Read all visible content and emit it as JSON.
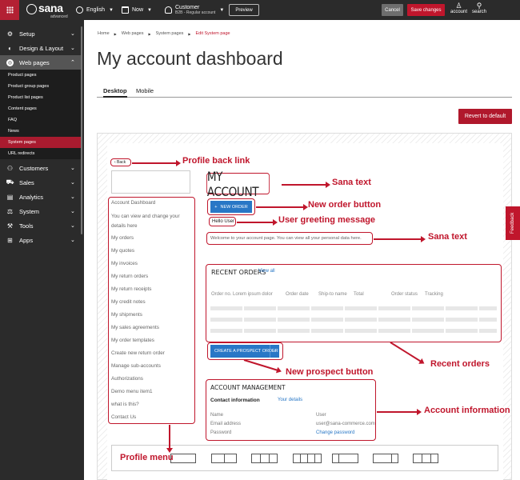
{
  "topbar": {
    "brand": "sana",
    "brand_sub": "advanced",
    "language": "English",
    "date": "Now",
    "customer_name": "Customer",
    "customer_type": "B2B - Regular account",
    "preview": "Preview",
    "cancel": "Cancel",
    "save": "Save changes",
    "account": "account",
    "search": "search"
  },
  "sidebar": {
    "items": [
      {
        "label": "Setup",
        "icon": "gear-icon"
      },
      {
        "label": "Design & Layout",
        "icon": "palette-icon"
      },
      {
        "label": "Web pages",
        "icon": "globe-icon"
      },
      {
        "label": "Customers",
        "icon": "people-icon"
      },
      {
        "label": "Sales",
        "icon": "cart-icon"
      },
      {
        "label": "Analytics",
        "icon": "chart-icon"
      },
      {
        "label": "System",
        "icon": "system-icon"
      },
      {
        "label": "Tools",
        "icon": "wrench-icon"
      },
      {
        "label": "Apps",
        "icon": "apps-icon"
      }
    ],
    "subitems": [
      "Product pages",
      "Product group pages",
      "Product list pages",
      "Content pages",
      "FAQ",
      "News",
      "System pages",
      "URL redirects"
    ]
  },
  "breadcrumb": [
    "Home",
    "Web pages",
    "System pages",
    "Edit System page"
  ],
  "page_title": "My account dashboard",
  "tabs": [
    "Desktop",
    "Mobile"
  ],
  "revert": "Revert to default",
  "feedback": "Feedback",
  "preview": {
    "back": "‹ Back",
    "menu": [
      "Account Dashboard",
      "You can view and change your details here",
      "My orders",
      "My quotes",
      "My invoices",
      "My return orders",
      "My return receipts",
      "My credit notes",
      "My shipments",
      "My sales agreements",
      "My order templates",
      "Create new return order",
      "Manage sub-accounts",
      "Authorizations",
      "Demo menu item1",
      "what is this?",
      "Contact Us"
    ],
    "heading": "MY ACCOUNT",
    "new_order": "NEW ORDER",
    "hello": "Hello User",
    "welcome": "Welcome to your account page. You can view all your personal data here.",
    "recent_orders": "RECENT ORDERS",
    "view_all": "View all",
    "columns": [
      "Order no. Lorem ipsum dolor",
      "Order date",
      "Ship-to name",
      "Total",
      "Order status",
      "Tracking"
    ],
    "create_prospect": "CREATE A PROSPECT ORDER",
    "account_mgmt": "ACCOUNT MANAGEMENT",
    "contact_info": "Contact information",
    "your_details": "Your details",
    "fields": [
      {
        "label": "Name",
        "value": "User"
      },
      {
        "label": "Email address",
        "value": "user@sana-commerce.com"
      },
      {
        "label": "Password",
        "value": "Change password"
      }
    ]
  },
  "annotations": {
    "profile_back_link": "Profile back link",
    "sana_text_1": "Sana text",
    "new_order_button": "New order button",
    "user_greeting": "User greeting message",
    "sana_text_2": "Sana text",
    "recent_orders": "Recent orders",
    "new_prospect_button": "New prospect button",
    "account_information": "Account information",
    "profile_menu": "Profile menu"
  },
  "colors": {
    "accent": "#c0162c",
    "link": "#2877c6",
    "dark": "#2b2b2b"
  }
}
